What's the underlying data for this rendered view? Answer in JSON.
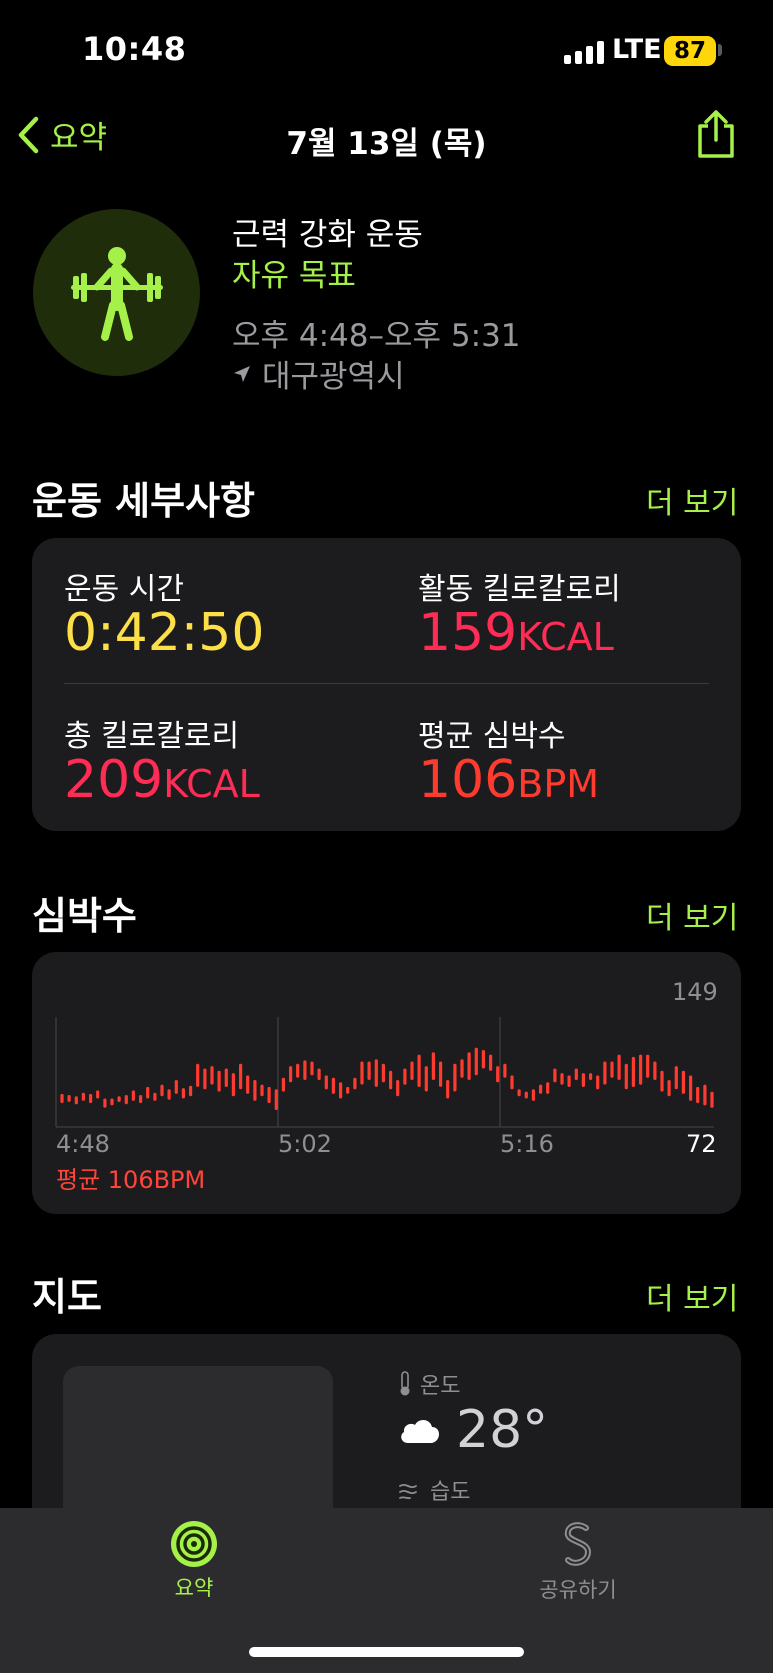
{
  "status_bar": {
    "time": "10:48",
    "network": "LTE",
    "battery": "87"
  },
  "nav": {
    "back_label": "요약",
    "title": "7월 13일 (목)"
  },
  "workout": {
    "name": "근력 강화 운동",
    "goal": "자유 목표",
    "time_range": "오후 4:48–오후 5:31",
    "location": "대구광역시"
  },
  "details": {
    "title": "운동 세부사항",
    "more": "더 보기",
    "duration": {
      "label": "운동 시간",
      "value": "0:42:50"
    },
    "active_kcal": {
      "label": "활동 킬로칼로리",
      "value": "159",
      "unit": "KCAL"
    },
    "total_kcal": {
      "label": "총 킬로칼로리",
      "value": "209",
      "unit": "KCAL"
    },
    "avg_hr": {
      "label": "평균 심박수",
      "value": "106",
      "unit": "BPM"
    }
  },
  "heart_rate": {
    "title": "심박수",
    "more": "더 보기",
    "max_label": "149",
    "min_label": "72",
    "x_labels": [
      "4:48",
      "5:02",
      "5:16"
    ],
    "average_text": "평균 106BPM"
  },
  "chart_data": {
    "type": "bar",
    "ylim": [
      72,
      149
    ],
    "x_labels": [
      "4:48",
      "5:02",
      "5:16"
    ],
    "ranges": [
      [
        84,
        92
      ],
      [
        85,
        91
      ],
      [
        83,
        90
      ],
      [
        86,
        93
      ],
      [
        84,
        92
      ],
      [
        88,
        95
      ],
      [
        80,
        88
      ],
      [
        82,
        88
      ],
      [
        85,
        90
      ],
      [
        83,
        91
      ],
      [
        86,
        95
      ],
      [
        84,
        91
      ],
      [
        88,
        98
      ],
      [
        86,
        93
      ],
      [
        90,
        100
      ],
      [
        87,
        96
      ],
      [
        92,
        104
      ],
      [
        88,
        97
      ],
      [
        90,
        99
      ],
      [
        98,
        118
      ],
      [
        96,
        114
      ],
      [
        100,
        116
      ],
      [
        94,
        112
      ],
      [
        98,
        114
      ],
      [
        90,
        110
      ],
      [
        96,
        118
      ],
      [
        92,
        108
      ],
      [
        86,
        104
      ],
      [
        90,
        100
      ],
      [
        84,
        98
      ],
      [
        78,
        96
      ],
      [
        94,
        106
      ],
      [
        102,
        116
      ],
      [
        106,
        118
      ],
      [
        104,
        121
      ],
      [
        108,
        120
      ],
      [
        104,
        114
      ],
      [
        96,
        108
      ],
      [
        92,
        106
      ],
      [
        88,
        102
      ],
      [
        92,
        98
      ],
      [
        96,
        106
      ],
      [
        100,
        120
      ],
      [
        104,
        120
      ],
      [
        98,
        122
      ],
      [
        102,
        118
      ],
      [
        96,
        112
      ],
      [
        90,
        104
      ],
      [
        100,
        114
      ],
      [
        104,
        120
      ],
      [
        98,
        126
      ],
      [
        94,
        116
      ],
      [
        104,
        128
      ],
      [
        98,
        120
      ],
      [
        88,
        104
      ],
      [
        94,
        118
      ],
      [
        106,
        122
      ],
      [
        104,
        128
      ],
      [
        108,
        132
      ],
      [
        114,
        130
      ],
      [
        112,
        126
      ],
      [
        102,
        116
      ],
      [
        106,
        118
      ],
      [
        96,
        108
      ],
      [
        90,
        96
      ],
      [
        88,
        94
      ],
      [
        86,
        96
      ],
      [
        92,
        100
      ],
      [
        92,
        102
      ],
      [
        102,
        114
      ],
      [
        100,
        110
      ],
      [
        98,
        108
      ],
      [
        104,
        114
      ],
      [
        98,
        110
      ],
      [
        104,
        110
      ],
      [
        96,
        108
      ],
      [
        100,
        120
      ],
      [
        106,
        120
      ],
      [
        104,
        126
      ],
      [
        96,
        118
      ],
      [
        98,
        124
      ],
      [
        100,
        126
      ],
      [
        106,
        126
      ],
      [
        104,
        120
      ],
      [
        94,
        112
      ],
      [
        90,
        104
      ],
      [
        96,
        116
      ],
      [
        92,
        112
      ],
      [
        86,
        108
      ],
      [
        84,
        98
      ],
      [
        82,
        100
      ],
      [
        80,
        94
      ]
    ]
  },
  "map": {
    "title": "지도",
    "more": "더 보기",
    "temp_label": "온도",
    "temperature": "28°",
    "humidity_label": "습도"
  },
  "tabs": [
    {
      "label": "요약",
      "active": true
    },
    {
      "label": "공유하기",
      "active": false
    }
  ],
  "colors": {
    "accent": "#a6f04a",
    "duration": "#fde047",
    "kcal": "#ff2d55",
    "bpm": "#ff3b30"
  }
}
